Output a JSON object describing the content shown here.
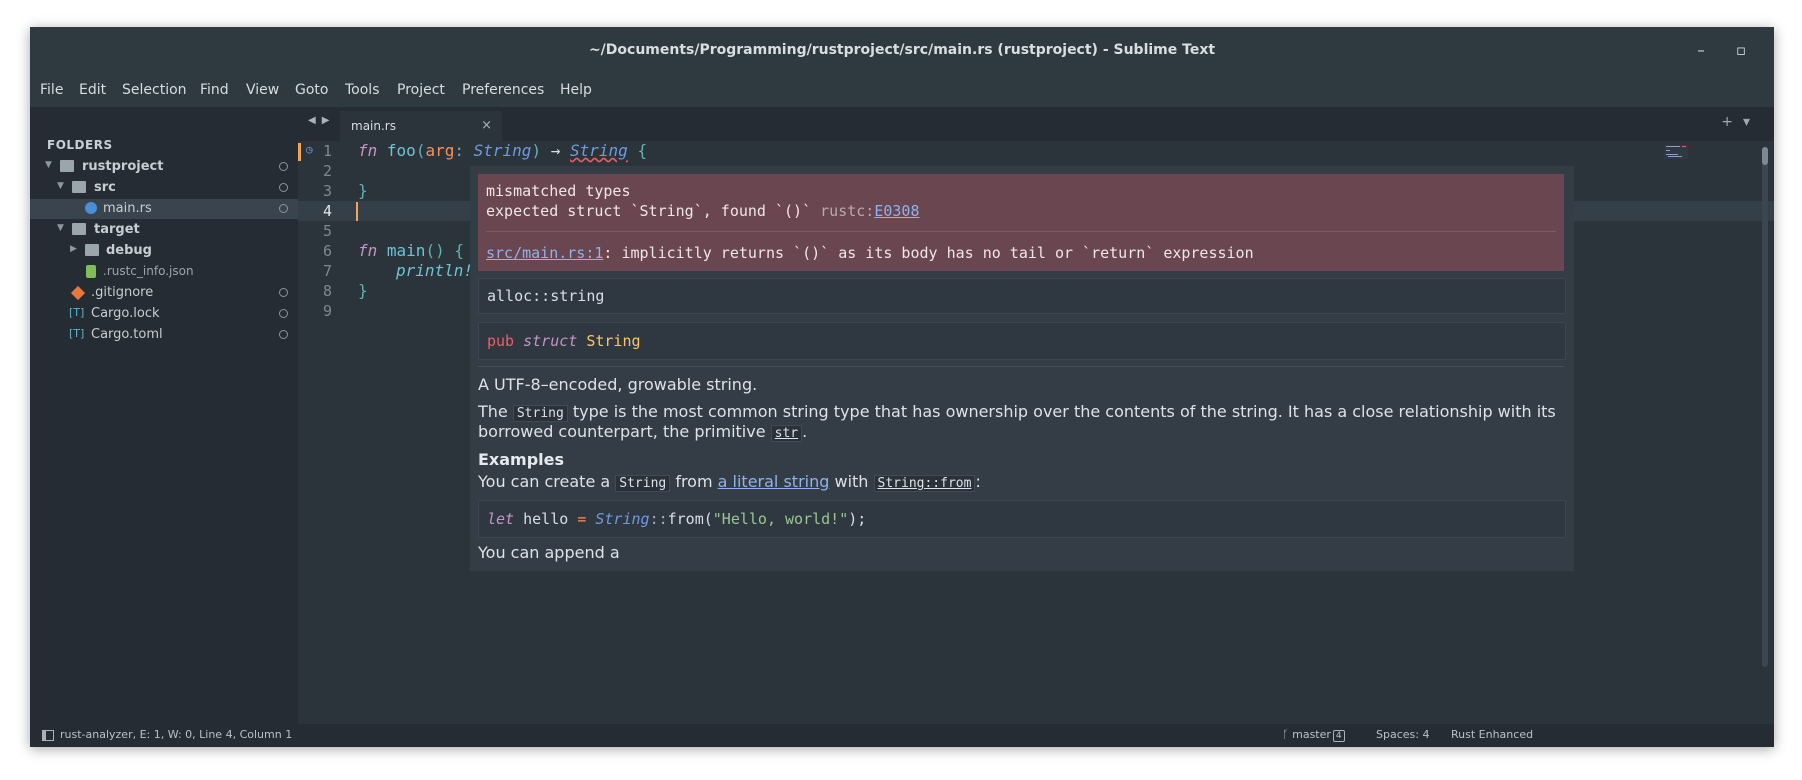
{
  "window": {
    "title": "~/Documents/Programming/rustproject/src/main.rs (rustproject) - Sublime Text"
  },
  "menu": [
    "File",
    "Edit",
    "Selection",
    "Find",
    "View",
    "Goto",
    "Tools",
    "Project",
    "Preferences",
    "Help"
  ],
  "sidebar": {
    "title": "FOLDERS",
    "items": [
      {
        "label": "rustproject",
        "icon": "folder-open-icon"
      },
      {
        "label": "src",
        "icon": "folder-open-icon"
      },
      {
        "label": "main.rs",
        "icon": "rust-file-icon"
      },
      {
        "label": "target",
        "icon": "folder-open-icon"
      },
      {
        "label": "debug",
        "icon": "folder-icon"
      },
      {
        "label": ".rustc_info.json",
        "icon": "json-file-icon"
      },
      {
        "label": ".gitignore",
        "icon": "git-icon"
      },
      {
        "label": "Cargo.lock",
        "icon": "toml-file-icon"
      },
      {
        "label": "Cargo.toml",
        "icon": "toml-file-icon"
      }
    ]
  },
  "tabs": [
    {
      "label": "main.rs",
      "close": "×"
    }
  ],
  "editor": {
    "line_numbers": [
      "1",
      "2",
      "3",
      "4",
      "5",
      "6",
      "7",
      "8",
      "9"
    ],
    "current_line": "4",
    "code": {
      "l1": {
        "fn": "fn",
        "name": "foo",
        "open": "(",
        "param": "arg",
        "colon": ":",
        "type": "String",
        "close": ")",
        "arrow": "→",
        "ret": "String",
        "brace": "{"
      },
      "l3": "}",
      "l6": {
        "fn": "fn",
        "name": "main",
        "parens": "()",
        "brace": "{"
      },
      "l7": "println!",
      "l8": "}"
    }
  },
  "popup": {
    "diagnostic": {
      "title": "mismatched types",
      "expected": "expected struct `String`, found `()` ",
      "code_prefix": "rustc:",
      "code": "E0308",
      "location": "src/main.rs:1",
      "note": ": implicitly returns `()` as its body has no tail or `return` expression"
    },
    "module": "alloc::string",
    "signature": {
      "pub": "pub",
      "struct": "struct",
      "name": "String"
    },
    "doc": {
      "summary": "A UTF-8–encoded, growable string.",
      "p1a": "The ",
      "p1code": "String",
      "p1b": " type is the most common string type that has ownership over the contents of the string. It has a close relationship with its",
      "p1c": "borrowed counterpart, the primitive ",
      "p1code2": "str",
      "p1d": ".",
      "examples_heading": "Examples",
      "p2a": "You can create a ",
      "p2code": "String",
      "p2b": " from ",
      "p2link": "a literal string",
      "p2c": " with ",
      "p2code2": "String::from",
      "p2d": ":",
      "example": {
        "let": "let",
        "var": "hello",
        "eq": "=",
        "type": "String",
        "sep": "::",
        "call": "from(",
        "str": "\"Hello, world!\"",
        "end": ");"
      },
      "p3": "You can append a"
    }
  },
  "status": {
    "left": "rust-analyzer, E: 1, W: 0, Line 4, Column 1",
    "branch": "master",
    "branch_count": "4",
    "spaces": "Spaces: 4",
    "syntax": "Rust Enhanced"
  },
  "colors": {
    "accent": "#f0a65a",
    "error_bg": "#6a4651",
    "link": "#8db3ec"
  }
}
